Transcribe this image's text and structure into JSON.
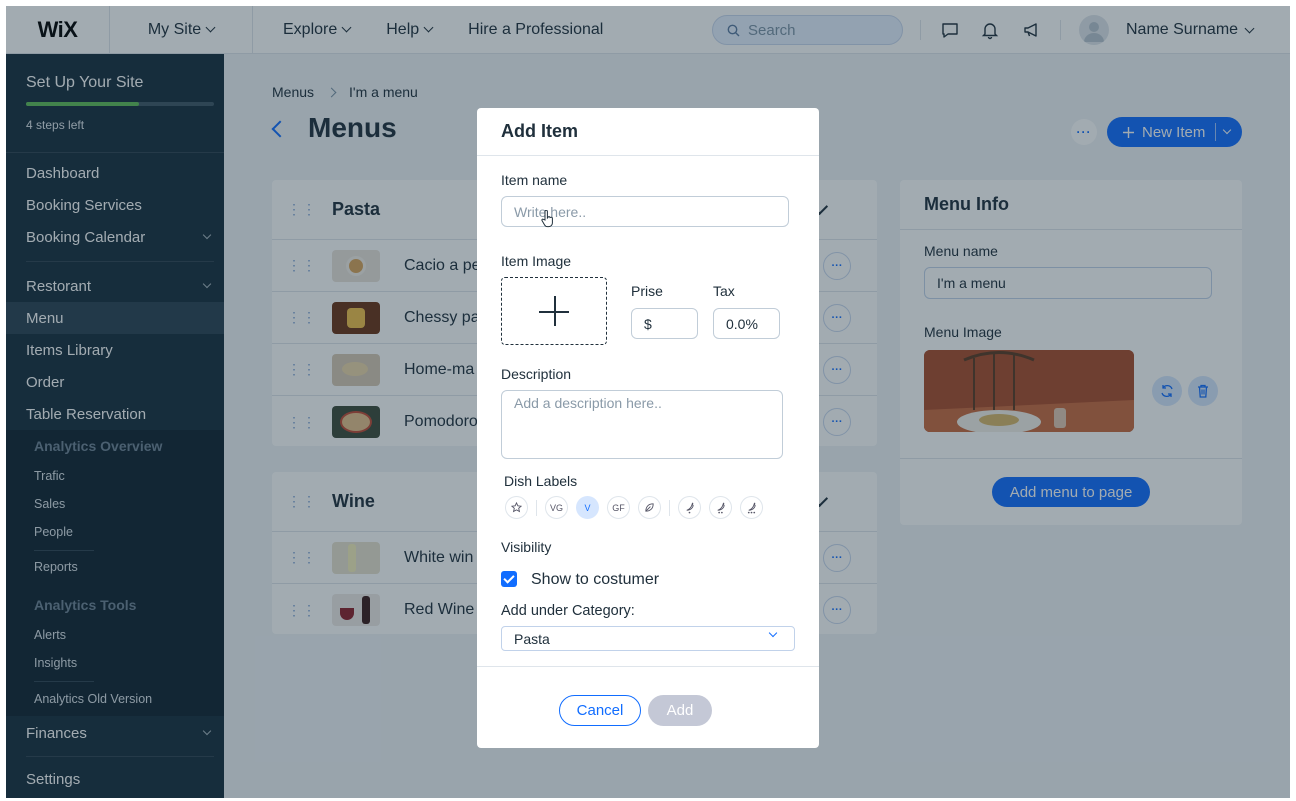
{
  "topbar": {
    "logo": "WiX",
    "site": "My Site",
    "nav": [
      "Explore",
      "Help",
      "Hire a Professional"
    ],
    "search_placeholder": "Search",
    "icons": [
      "chat-icon",
      "bell-icon",
      "megaphone-icon"
    ],
    "user": "Name Surname"
  },
  "sidebar": {
    "setup_title": "Set Up Your Site",
    "setup_progress": 0.6,
    "setup_steps": "4 steps left",
    "items": [
      {
        "label": "Dashboard"
      },
      {
        "label": "Booking Services"
      },
      {
        "label": "Booking Calendar",
        "expandable": true
      },
      {
        "label": "Restorant",
        "expandable": true
      },
      {
        "label": "Menu",
        "active": true
      },
      {
        "label": "Items Library"
      },
      {
        "label": "Order"
      },
      {
        "label": "Table Reservation"
      }
    ],
    "analytics_head": "Analytics Overview",
    "analytics_items": [
      "Trafic",
      "Sales",
      "People",
      "Reports"
    ],
    "tools_head": "Analytics Tools",
    "tools_items": [
      "Alerts",
      "Insights",
      "Analytics Old Version"
    ],
    "finances": "Finances",
    "settings": "Settings"
  },
  "main": {
    "breadcrumb": [
      "Menus",
      "I'm a menu"
    ],
    "title": "Menus",
    "new_item": "New Item",
    "categories": [
      {
        "title": "Pasta",
        "items": [
          "Cacio a pe",
          "Chessy pa",
          "Home-ma",
          "Pomodoro"
        ]
      },
      {
        "title": "Wine",
        "items": [
          "White win",
          "Red Wine"
        ]
      }
    ],
    "info": {
      "title": "Menu Info",
      "name_label": "Menu name",
      "name_value": "I'm a menu",
      "image_label": "Menu Image",
      "add_to_page": "Add menu to page"
    }
  },
  "modal": {
    "title": "Add Item",
    "item_name_label": "Item name",
    "item_name_placeholder": "Write here..",
    "item_image_label": "Item Image",
    "price_label": "Prise",
    "price_value": "$",
    "tax_label": "Tax",
    "tax_value": "0.0%",
    "description_label": "Description",
    "description_placeholder": "Add a description here..",
    "dish_labels_title": "Dish Labels",
    "dish_labels": [
      "star",
      "VG",
      "V",
      "GF",
      "leaf",
      "chili-1",
      "chili-2",
      "chili-3"
    ],
    "dish_labels_selected": "V",
    "visibility_label": "Visibility",
    "show_label": "Show to costumer",
    "show_checked": true,
    "category_label": "Add under Category:",
    "category_value": "Pasta",
    "cancel": "Cancel",
    "add": "Add"
  },
  "colors": {
    "accent": "#116dff",
    "sidebar": "#162d3d",
    "progress": "#60bc57"
  }
}
